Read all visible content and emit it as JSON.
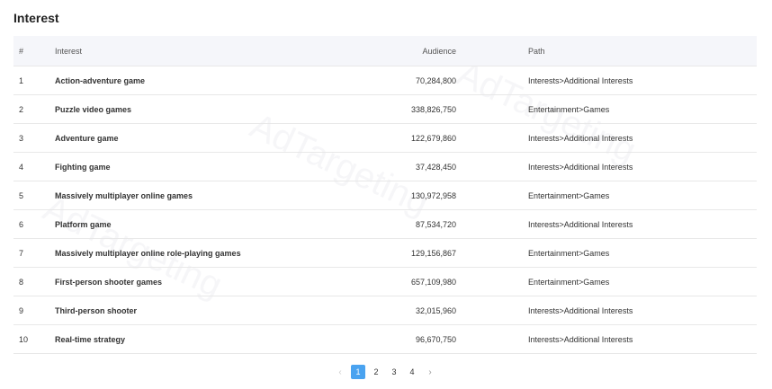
{
  "page": {
    "title": "Interest",
    "watermark": "AdTargeting"
  },
  "table": {
    "headers": {
      "index": "#",
      "interest": "Interest",
      "audience": "Audience",
      "path": "Path"
    },
    "rows": [
      {
        "index": "1",
        "interest": "Action-adventure game",
        "audience": "70,284,800",
        "path": "Interests>Additional Interests"
      },
      {
        "index": "2",
        "interest": "Puzzle video games",
        "audience": "338,826,750",
        "path": "Entertainment>Games"
      },
      {
        "index": "3",
        "interest": "Adventure game",
        "audience": "122,679,860",
        "path": "Interests>Additional Interests"
      },
      {
        "index": "4",
        "interest": "Fighting game",
        "audience": "37,428,450",
        "path": "Interests>Additional Interests"
      },
      {
        "index": "5",
        "interest": "Massively multiplayer online games",
        "audience": "130,972,958",
        "path": "Entertainment>Games"
      },
      {
        "index": "6",
        "interest": "Platform game",
        "audience": "87,534,720",
        "path": "Interests>Additional Interests"
      },
      {
        "index": "7",
        "interest": "Massively multiplayer online role-playing games",
        "audience": "129,156,867",
        "path": "Entertainment>Games"
      },
      {
        "index": "8",
        "interest": "First-person shooter games",
        "audience": "657,109,980",
        "path": "Entertainment>Games"
      },
      {
        "index": "9",
        "interest": "Third-person shooter",
        "audience": "32,015,960",
        "path": "Interests>Additional Interests"
      },
      {
        "index": "10",
        "interest": "Real-time strategy",
        "audience": "96,670,750",
        "path": "Interests>Additional Interests"
      }
    ]
  },
  "pagination": {
    "prev_icon": "chevron-left-icon",
    "next_icon": "chevron-right-icon",
    "pages": [
      "1",
      "2",
      "3",
      "4"
    ],
    "current": "1",
    "accent_color": "#4aa3f0"
  }
}
